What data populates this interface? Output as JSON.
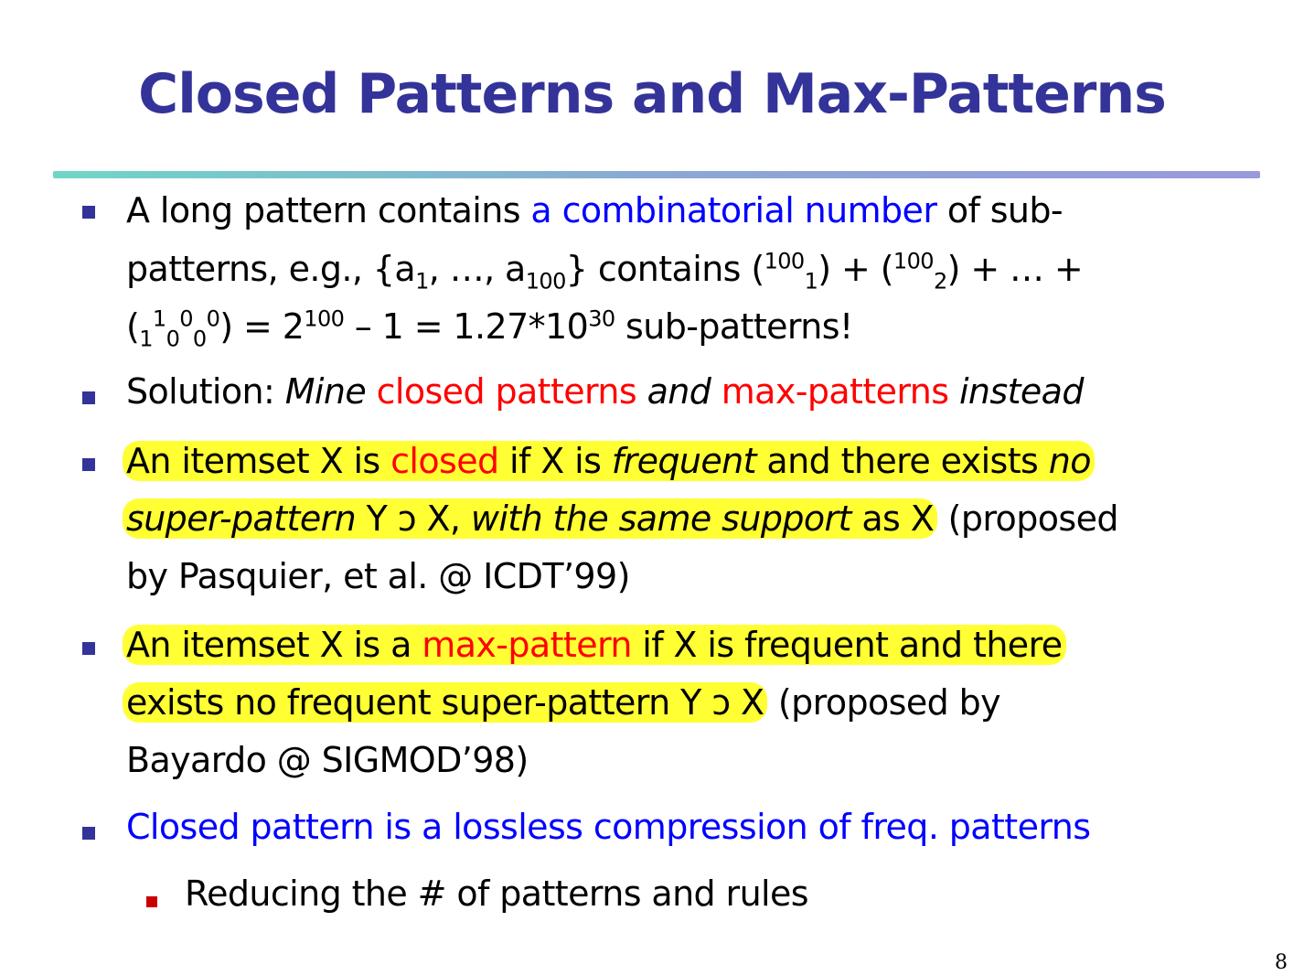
{
  "title": "Closed Patterns and Max-Patterns",
  "b1": {
    "l1a": "A long pattern contains ",
    "l1b": "a combinatorial number",
    "l1c": " of sub-",
    "l2a": "patterns, e.g., {a",
    "l2s1": "1",
    "l2b": ", …, a",
    "l2s2": "100",
    "l2c": "} contains (",
    "l2p1": "100",
    "l2s3": "1",
    "l2d": ") + (",
    "l2p2": "100",
    "l2s4": "2",
    "l2e": ") + … +",
    "l3a": "(",
    "l3s1": "1",
    "l3p1": "1",
    "l3s2": "0",
    "l3p2": "0",
    "l3s3": "0",
    "l3p3": "0",
    "l3b": ") = 2",
    "l3p4": "100",
    "l3c": " – 1 = 1.27*10",
    "l3p5": "30",
    "l3d": " sub-patterns!"
  },
  "b2": {
    "a": "Solution: ",
    "b": "Mine",
    "c": " closed patterns",
    "d": " and",
    "e": " max-patterns",
    "f": " instead"
  },
  "b3": {
    "l1a": "An itemset X is ",
    "l1b": "closed",
    "l1c": " if X is ",
    "l1d": "frequent",
    "l1e": " and there exists ",
    "l1f": "no",
    "l2a": "super-pattern",
    "l2b": " Y ɔ X, ",
    "l2c": "with the same support",
    "l2d": " as X",
    "l2e": " (proposed",
    "l3": "by Pasquier, et al. @ ICDT’99)"
  },
  "b4": {
    "l1a": "An itemset X is a ",
    "l1b": "max-pattern",
    "l1c": " if X is frequent and there",
    "l2a": "exists no frequent super-pattern Y ɔ X",
    "l2b": " (proposed by",
    "l3": "Bayardo @ SIGMOD’98)"
  },
  "b5": "Closed pattern is a lossless compression of freq. patterns",
  "sub1": "Reducing the # of patterns and rules",
  "page_number": "8",
  "colors": {
    "title": "#333399",
    "blue": "#0000ff",
    "red": "#ff0000",
    "highlight": "#ffff33"
  }
}
